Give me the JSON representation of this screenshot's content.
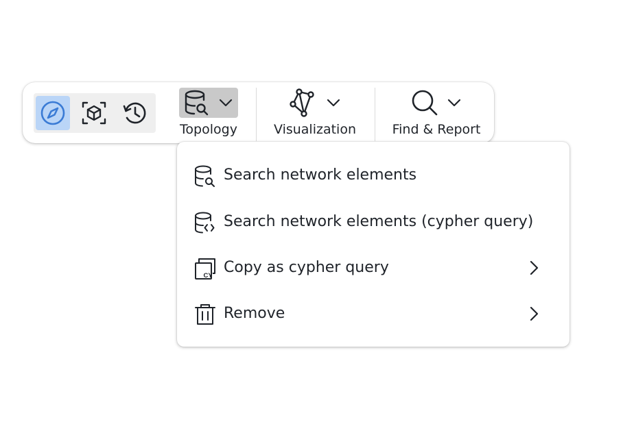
{
  "toolbar": {
    "modes": [
      {
        "icon": "compass-icon",
        "active": true
      },
      {
        "icon": "3d-box-focus-icon",
        "active": false
      },
      {
        "icon": "history-icon",
        "active": false
      }
    ],
    "groups": [
      {
        "label": "Topology",
        "icon": "database-search-icon",
        "has_dropdown": true,
        "open": true
      },
      {
        "label": "Visualization",
        "icon": "graph-nodes-icon",
        "has_dropdown": true,
        "open": false
      },
      {
        "label": "Find & Report",
        "icon": "magnifier-icon",
        "has_dropdown": true,
        "open": false
      }
    ]
  },
  "dropdown_menu": {
    "items": [
      {
        "label": "Search network elements",
        "icon": "database-search-icon",
        "submenu": false
      },
      {
        "label": "Search network elements (cypher query)",
        "icon": "database-code-icon",
        "submenu": false
      },
      {
        "label": "Copy as cypher query",
        "icon": "copy-cypher-icon",
        "submenu": true
      },
      {
        "label": "Remove",
        "icon": "trash-icon",
        "submenu": true
      }
    ]
  },
  "colors": {
    "active_mode_bg": "#bad5f7",
    "active_mode_icon": "#3a7bd5",
    "open_group_bg": "#c9c9c9",
    "mode_group_bg": "#efefef",
    "text": "#1f2329"
  }
}
